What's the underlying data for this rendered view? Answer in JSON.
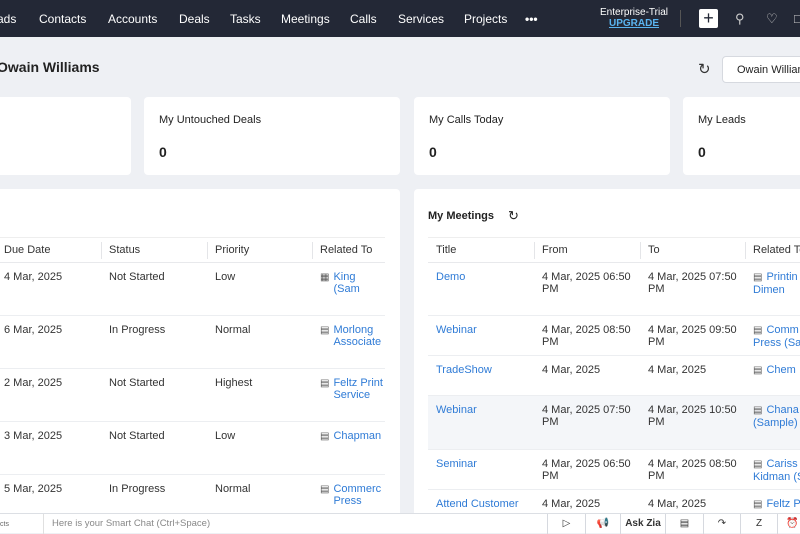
{
  "nav": {
    "items": [
      "ads",
      "Contacts",
      "Accounts",
      "Deals",
      "Tasks",
      "Meetings",
      "Calls",
      "Services",
      "Projects",
      "•••"
    ],
    "trial": "Enterprise-Trial",
    "upgrade": "UPGRADE"
  },
  "header": {
    "title": "Owain Williams",
    "user_button": "Owain Williams"
  },
  "cards": [
    {
      "label": "",
      "value": ""
    },
    {
      "label": "My Untouched Deals",
      "value": "0"
    },
    {
      "label": "My Calls Today",
      "value": "0"
    },
    {
      "label": "My Leads",
      "value": "0"
    }
  ],
  "tasks": {
    "columns": [
      "Due Date",
      "Status",
      "Priority",
      "Related To"
    ],
    "rows": [
      {
        "due": "4 Mar, 2025",
        "status": "Not Started",
        "priority": "Low",
        "related": "King (Sam",
        "icon": "building"
      },
      {
        "due": "6 Mar, 2025",
        "status": "In Progress",
        "priority": "Normal",
        "related": "Morlong Associate",
        "icon": "wallet"
      },
      {
        "due": "2 Mar, 2025",
        "status": "Not Started",
        "priority": "Highest",
        "related": "Feltz Print Service",
        "icon": "wallet"
      },
      {
        "due": "3 Mar, 2025",
        "status": "Not Started",
        "priority": "Low",
        "related": "Chapman",
        "icon": "wallet"
      },
      {
        "due": "5 Mar, 2025",
        "status": "In Progress",
        "priority": "Normal",
        "related": "Commerc Press",
        "icon": "wallet"
      }
    ]
  },
  "meetings": {
    "title": "My Meetings",
    "columns": [
      "Title",
      "From",
      "To",
      "Related To"
    ],
    "rows": [
      {
        "title": "Demo",
        "from": "4 Mar, 2025 06:50 PM",
        "to": "4 Mar, 2025 07:50 PM",
        "related": "Printin Dimen"
      },
      {
        "title": "Webinar",
        "from": "4 Mar, 2025 08:50 PM",
        "to": "4 Mar, 2025 09:50 PM",
        "related": "Comm Press (Sar"
      },
      {
        "title": "TradeShow",
        "from": "4 Mar, 2025",
        "to": "4 Mar, 2025",
        "related": "Chem"
      },
      {
        "title": "Webinar",
        "from": "4 Mar, 2025 07:50 PM",
        "to": "4 Mar, 2025 10:50 PM",
        "related": "Chana (Sample)"
      },
      {
        "title": "Seminar",
        "from": "4 Mar, 2025 06:50 PM",
        "to": "4 Mar, 2025 08:50 PM",
        "related": "Cariss Kidman (S"
      },
      {
        "title": "Attend Customer",
        "from": "4 Mar, 2025",
        "to": "4 Mar, 2025",
        "related": "Feltz P"
      }
    ]
  },
  "bottom": {
    "left": "cts",
    "chat_placeholder": "Here is your Smart Chat (Ctrl+Space)",
    "ask_zia": "Ask Zia"
  }
}
